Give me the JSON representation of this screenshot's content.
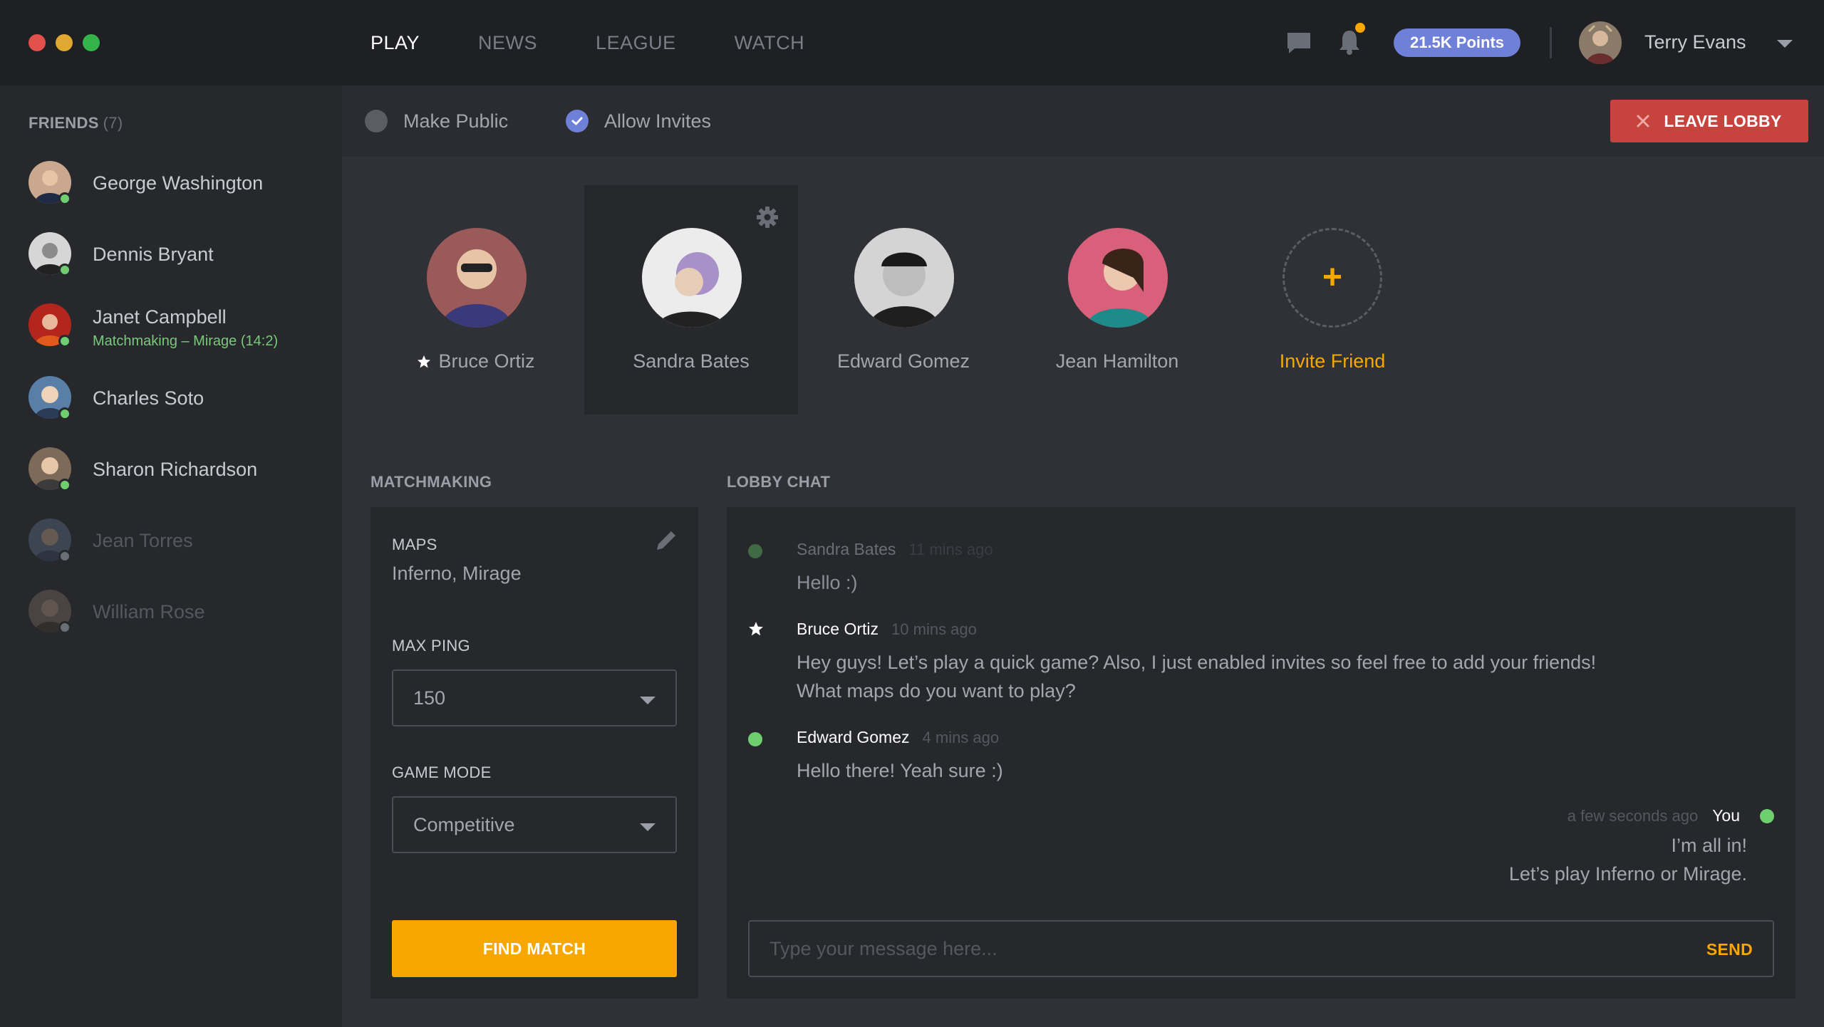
{
  "nav": {
    "items": [
      "PLAY",
      "NEWS",
      "LEAGUE",
      "WATCH"
    ],
    "active": "PLAY"
  },
  "header": {
    "points": "21.5K Points",
    "user_name": "Terry Evans",
    "accent_color": "#6f80d9",
    "notification_color": "#f8a700"
  },
  "sidebar": {
    "title": "FRIENDS",
    "count": "(7)",
    "friends": [
      {
        "name": "George Washington",
        "status": "online"
      },
      {
        "name": "Dennis Bryant",
        "status": "online"
      },
      {
        "name": "Janet Campbell",
        "status": "online",
        "activity": "Matchmaking – Mirage (14:2)"
      },
      {
        "name": "Charles Soto",
        "status": "online"
      },
      {
        "name": "Sharon Richardson",
        "status": "online"
      },
      {
        "name": "Jean Torres",
        "status": "offline"
      },
      {
        "name": "William Rose",
        "status": "offline"
      }
    ]
  },
  "lobby": {
    "make_public_label": "Make Public",
    "make_public_checked": false,
    "allow_invites_label": "Allow Invites",
    "allow_invites_checked": true,
    "leave_label": "LEAVE LOBBY",
    "members": [
      {
        "name": "Bruce Ortiz",
        "leader": true
      },
      {
        "name": "Sandra Bates",
        "selected": true
      },
      {
        "name": "Edward Gomez"
      },
      {
        "name": "Jean Hamilton"
      }
    ],
    "invite_label": "Invite Friend"
  },
  "matchmaking": {
    "title": "MATCHMAKING",
    "maps_label": "MAPS",
    "maps_value": "Inferno, Mirage",
    "max_ping_label": "MAX PING",
    "max_ping_value": "150",
    "game_mode_label": "GAME MODE",
    "game_mode_value": "Competitive",
    "find_label": "FIND MATCH"
  },
  "chat": {
    "title": "LOBBY CHAT",
    "messages": [
      {
        "author": "Sandra Bates",
        "time": "11 mins ago",
        "lines": [
          "Hello :)"
        ]
      },
      {
        "author": "Bruce Ortiz",
        "time": "10 mins ago",
        "lines": [
          "Hey guys! Let’s play a quick game? Also, I just enabled invites so feel free to add your friends!",
          "What maps do you want to play?"
        ]
      },
      {
        "author": "Edward Gomez",
        "time": "4 mins ago",
        "lines": [
          "Hello there! Yeah sure :)"
        ]
      }
    ],
    "self_message": {
      "author": "You",
      "time": "a few seconds ago",
      "lines": [
        "I’m all in!",
        "Let’s play Inferno or Mirage."
      ]
    },
    "input_placeholder": "Type your message here...",
    "send_label": "SEND"
  }
}
